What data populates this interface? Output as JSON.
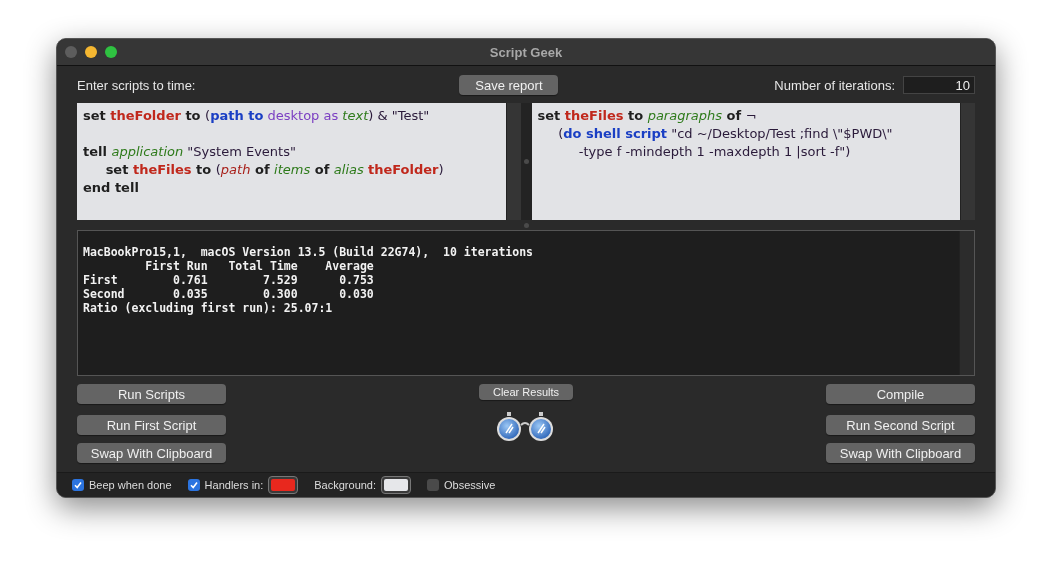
{
  "window": {
    "title": "Script Geek"
  },
  "header": {
    "prompt": "Enter scripts to time:",
    "save_button": "Save report",
    "iterations_label": "Number of iterations:",
    "iterations_value": "10"
  },
  "scripts": [
    {
      "paragraphs": [
        {
          "lines": [
            [
              {
                "kind": "keyword",
                "text": "set "
              },
              {
                "kind": "variable",
                "text": "theFolder"
              },
              {
                "kind": "keyword",
                "text": " to "
              },
              {
                "kind": "plain",
                "text": "("
              },
              {
                "kind": "command",
                "text": "path to"
              },
              {
                "kind": "enum",
                "text": " desktop as "
              },
              {
                "kind": "class",
                "text": "text"
              },
              {
                "kind": "plain",
                "text": ") & \"Test\""
              }
            ]
          ]
        },
        {
          "lines": [
            [
              {
                "kind": "keyword",
                "text": "tell "
              },
              {
                "kind": "class",
                "text": "application"
              },
              {
                "kind": "plain",
                "text": " \"System Events\""
              }
            ],
            [
              {
                "kind": "keyword",
                "text": "     set "
              },
              {
                "kind": "variable",
                "text": "theFiles"
              },
              {
                "kind": "keyword",
                "text": " to "
              },
              {
                "kind": "plain",
                "text": "("
              },
              {
                "kind": "property",
                "text": "path"
              },
              {
                "kind": "keyword",
                "text": " of "
              },
              {
                "kind": "class",
                "text": "items"
              },
              {
                "kind": "keyword",
                "text": " of "
              },
              {
                "kind": "class",
                "text": "alias "
              },
              {
                "kind": "variable",
                "text": "theFolder"
              },
              {
                "kind": "plain",
                "text": ")"
              }
            ],
            [
              {
                "kind": "keyword",
                "text": "end tell"
              }
            ]
          ]
        }
      ]
    },
    {
      "paragraphs": [
        {
          "lines": [
            [
              {
                "kind": "keyword",
                "text": "set "
              },
              {
                "kind": "variable",
                "text": "theFiles"
              },
              {
                "kind": "keyword",
                "text": " to "
              },
              {
                "kind": "class",
                "text": "paragraphs"
              },
              {
                "kind": "keyword",
                "text": " of "
              },
              {
                "kind": "plain",
                "text": "¬"
              }
            ],
            [
              {
                "kind": "plain",
                "text": "     ("
              },
              {
                "kind": "command",
                "text": "do shell script"
              },
              {
                "kind": "plain",
                "text": " \"cd ~/Desktop/Test ;find \\\"$PWD\\\""
              }
            ],
            [
              {
                "kind": "plain",
                "text": "          -type f -mindepth 1 -maxdepth 1 |sort -f\")"
              }
            ]
          ]
        }
      ]
    }
  ],
  "results": [
    "MacBookPro15,1,  macOS Version 13.5 (Build 22G74),  10 iterations",
    "         First Run   Total Time    Average",
    "First        0.761        7.529      0.753",
    "Second       0.035        0.300      0.030",
    "Ratio (excluding first run): 25.07:1"
  ],
  "buttons_left": [
    "Run Scripts",
    "Run First Script",
    "Swap With Clipboard"
  ],
  "clear_button": "Clear Results",
  "buttons_right": [
    "Compile",
    "Run Second Script",
    "Swap With Clipboard"
  ],
  "options": [
    {
      "kind": "checkbox",
      "label": "Beep when done",
      "checked": true
    },
    {
      "kind": "checkbox-color",
      "label": "Handlers in:",
      "checked": true,
      "color": "#e8281e"
    },
    {
      "kind": "color",
      "label": "Background:",
      "color": "#e6e7ea"
    },
    {
      "kind": "checkbox",
      "label": "Obsessive",
      "checked": false
    }
  ]
}
